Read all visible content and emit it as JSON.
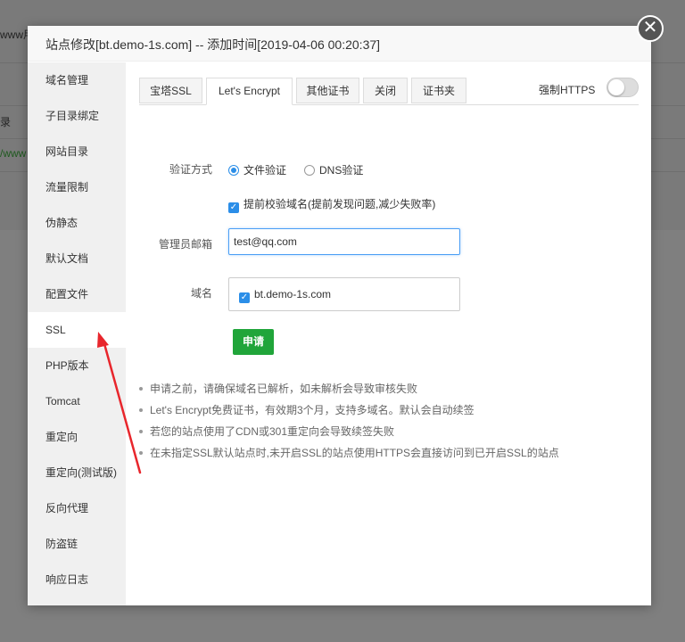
{
  "background": {
    "rows": [
      "www用",
      "录",
      "/www"
    ]
  },
  "modal": {
    "title": "站点修改[bt.demo-1s.com] -- 添加时间[2019-04-06 00:20:37]",
    "close_symbol": "✕"
  },
  "sidebar": {
    "items": [
      {
        "label": "域名管理"
      },
      {
        "label": "子目录绑定"
      },
      {
        "label": "网站目录"
      },
      {
        "label": "流量限制"
      },
      {
        "label": "伪静态"
      },
      {
        "label": "默认文档"
      },
      {
        "label": "配置文件"
      },
      {
        "label": "SSL"
      },
      {
        "label": "PHP版本"
      },
      {
        "label": "Tomcat"
      },
      {
        "label": "重定向"
      },
      {
        "label": "重定向(测试版)"
      },
      {
        "label": "反向代理"
      },
      {
        "label": "防盗链"
      },
      {
        "label": "响应日志"
      }
    ],
    "active_index": 7
  },
  "tabs": [
    {
      "label": "宝塔SSL"
    },
    {
      "label": "Let's Encrypt"
    },
    {
      "label": "其他证书"
    },
    {
      "label": "关闭"
    },
    {
      "label": "证书夹"
    }
  ],
  "active_tab": 1,
  "force_https": {
    "label": "强制HTTPS",
    "enabled": false
  },
  "form": {
    "verify_label": "验证方式",
    "verify_options": [
      {
        "label": "文件验证",
        "selected": true
      },
      {
        "label": "DNS验证",
        "selected": false
      }
    ],
    "precheck_label": "提前校验域名(提前发现问题,减少失败率)",
    "precheck_checked": true,
    "email_label": "管理员邮箱",
    "email_value": "test@qq.com",
    "domain_label": "域名",
    "domains": [
      {
        "name": "bt.demo-1s.com",
        "checked": true
      }
    ],
    "apply_label": "申请"
  },
  "notes": [
    "申请之前，请确保域名已解析，如未解析会导致审核失败",
    "Let's Encrypt免费证书，有效期3个月，支持多域名。默认会自动续签",
    "若您的站点使用了CDN或301重定向会导致续签失败",
    "在未指定SSL默认站点时,未开启SSL的站点使用HTTPS会直接访问到已开启SSL的站点"
  ],
  "colors": {
    "accent_green": "#20a53a",
    "accent_blue": "#2b8ee8",
    "arrow_red": "#e8262c"
  }
}
